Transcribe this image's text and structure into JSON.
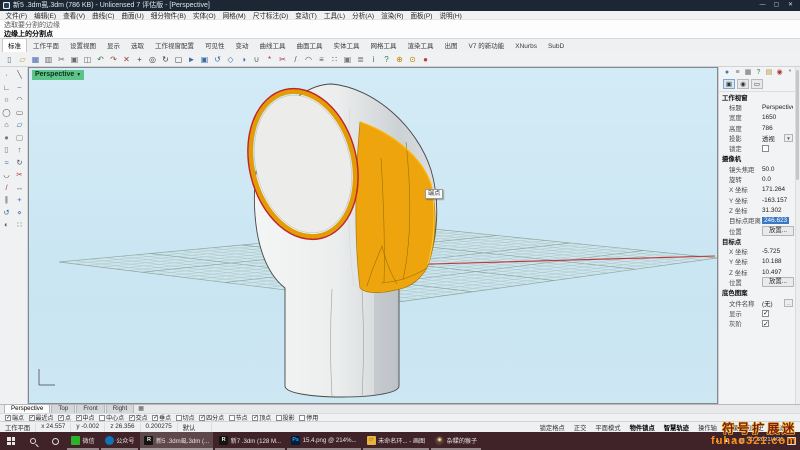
{
  "window": {
    "title": "新5 .3dm虱.3dm (786 KB) - Unlicensed 7 评估版 - [Perspective]",
    "minimize": "—",
    "maximize": "▢",
    "close": "✕"
  },
  "menu": {
    "items": [
      "文件(F)",
      "编辑(E)",
      "查看(V)",
      "曲线(C)",
      "曲面(U)",
      "细分物件(B)",
      "实体(O)",
      "网格(M)",
      "尺寸标注(D)",
      "变动(T)",
      "工具(L)",
      "分析(A)",
      "渲染(R)",
      "面板(P)",
      "说明(H)"
    ]
  },
  "command": {
    "history": "选取要分割的边缘",
    "prompt": "边缘上的分割点"
  },
  "ribbon_tabs": {
    "items": [
      {
        "label": "标准",
        "active": true
      },
      {
        "label": "工作平面"
      },
      {
        "label": "设置视图"
      },
      {
        "label": "显示"
      },
      {
        "label": "选取"
      },
      {
        "label": "工作视窗配置"
      },
      {
        "label": "可见性"
      },
      {
        "label": "变动"
      },
      {
        "label": "曲线工具"
      },
      {
        "label": "曲面工具"
      },
      {
        "label": "实体工具"
      },
      {
        "label": "网格工具"
      },
      {
        "label": "渲染工具"
      },
      {
        "label": "出图"
      },
      {
        "label": "V7 的新功能"
      },
      {
        "label": "XNurbs"
      },
      {
        "label": "SubD"
      }
    ]
  },
  "toolbar": {
    "icons": [
      {
        "n": "new-file-icon",
        "g": "▯",
        "css": "color:#56718a"
      },
      {
        "n": "open-file-icon",
        "g": "▱",
        "css": "color:#c9a24a"
      },
      {
        "n": "save-file-icon",
        "g": "▦",
        "css": "color:#4a6fae"
      },
      {
        "n": "print-icon",
        "g": "▥",
        "css": "color:#6a6a6a"
      },
      {
        "n": "cut-icon",
        "g": "✂",
        "css": "color:#6a6a6a"
      },
      {
        "n": "copy-icon",
        "g": "▣",
        "css": "color:#6a6a6a"
      },
      {
        "n": "paste-icon",
        "g": "◫",
        "css": "color:#6a6a6a"
      },
      {
        "n": "undo-icon",
        "g": "↶",
        "css": "color:#3b7c3b"
      },
      {
        "n": "redo-icon",
        "g": "↷",
        "css": "color:#8a4a3b"
      },
      {
        "n": "delete-icon",
        "g": "✕",
        "css": "color:#a33a3a"
      },
      {
        "n": "pan-icon",
        "g": "+",
        "css": "color:#444"
      },
      {
        "n": "zoom-icon",
        "g": "◎",
        "css": "color:#444"
      },
      {
        "n": "rotate-view-icon",
        "g": "↻",
        "css": "color:#444"
      },
      {
        "n": "zoom-extents-icon",
        "g": "▢",
        "css": "color:#444"
      },
      {
        "n": "move-icon",
        "g": "►",
        "css": "color:#3a6ea5"
      },
      {
        "n": "copy-object-icon",
        "g": "▣",
        "css": "color:#3a6ea5"
      },
      {
        "n": "rotate-icon",
        "g": "↺",
        "css": "color:#3a6ea5"
      },
      {
        "n": "scale-icon",
        "g": "◇",
        "css": "color:#3a6ea5"
      },
      {
        "n": "mirror-icon",
        "g": "◑",
        "css": "color:#3a6ea5"
      },
      {
        "n": "join-icon",
        "g": "∪",
        "css": "color:#555"
      },
      {
        "n": "explode-icon",
        "g": "*",
        "css": "color:#a33a3a"
      },
      {
        "n": "trim-icon",
        "g": "✂",
        "css": "color:#a33a3a"
      },
      {
        "n": "split-icon",
        "g": "/",
        "css": "color:#555"
      },
      {
        "n": "fillet-icon",
        "g": "◠",
        "css": "color:#555"
      },
      {
        "n": "offset-icon",
        "g": "≡",
        "css": "color:#555"
      },
      {
        "n": "array-icon",
        "g": "∷",
        "css": "color:#555"
      },
      {
        "n": "group-icon",
        "g": "▣",
        "css": "color:#777"
      },
      {
        "n": "layers-icon",
        "g": "≣",
        "css": "color:#777"
      },
      {
        "n": "properties-icon",
        "g": "i",
        "css": "color:#2a7a4a"
      },
      {
        "n": "help-icon",
        "g": "?",
        "css": "color:#2a7a4a"
      },
      {
        "n": "gumball-icon",
        "g": "⊕",
        "css": "color:#b58900"
      },
      {
        "n": "osnap-toggle-icon",
        "g": "⊙",
        "css": "color:#b58900"
      },
      {
        "n": "record-history-icon",
        "g": "●",
        "css": "color:#c03a3a"
      }
    ]
  },
  "left_toolbar": {
    "icons": [
      {
        "n": "point-tool-icon",
        "g": "·",
        "css": "color:#333"
      },
      {
        "n": "line-tool-icon",
        "g": "╲",
        "css": "color:#555"
      },
      {
        "n": "polyline-tool-icon",
        "g": "∟",
        "css": "color:#555"
      },
      {
        "n": "curve-tool-icon",
        "g": "~",
        "css": "color:#3a6ea5"
      },
      {
        "n": "circle-tool-icon",
        "g": "○",
        "css": "color:#555"
      },
      {
        "n": "arc-tool-icon",
        "g": "◠",
        "css": "color:#555"
      },
      {
        "n": "ellipse-tool-icon",
        "g": "◯",
        "css": "color:#555"
      },
      {
        "n": "rectangle-tool-icon",
        "g": "▭",
        "css": "color:#555"
      },
      {
        "n": "polygon-tool-icon",
        "g": "⌂",
        "css": "color:#555"
      },
      {
        "n": "surface-tool-icon",
        "g": "▱",
        "css": "color:#3a6ea5"
      },
      {
        "n": "sphere-tool-icon",
        "g": "●",
        "css": "color:#777"
      },
      {
        "n": "box-tool-icon",
        "g": "▢",
        "css": "color:#777"
      },
      {
        "n": "cylinder-tool-icon",
        "g": "▯",
        "css": "color:#777"
      },
      {
        "n": "extrude-tool-icon",
        "g": "↑",
        "css": "color:#555"
      },
      {
        "n": "loft-tool-icon",
        "g": "≈",
        "css": "color:#3a6ea5"
      },
      {
        "n": "revolve-tool-icon",
        "g": "↻",
        "css": "color:#555"
      },
      {
        "n": "fillet-curve-tool-icon",
        "g": "◡",
        "css": "color:#555"
      },
      {
        "n": "trim-tool-icon",
        "g": "✂",
        "css": "color:#a33a3a"
      },
      {
        "n": "split-tool-icon",
        "g": "/",
        "css": "color:#a33a3a"
      },
      {
        "n": "extend-tool-icon",
        "g": "↔",
        "css": "color:#555"
      },
      {
        "n": "offset-tool-icon",
        "g": "∥",
        "css": "color:#555"
      },
      {
        "n": "move-tool-icon",
        "g": "+",
        "css": "color:#3a6ea5"
      },
      {
        "n": "rotate-tool-icon",
        "g": "↺",
        "css": "color:#3a6ea5"
      },
      {
        "n": "scale-tool-icon",
        "g": "⋄",
        "css": "color:#3a6ea5"
      },
      {
        "n": "mirror-tool-icon",
        "g": "◐",
        "css": "color:#555"
      },
      {
        "n": "array-tool-icon",
        "g": "∷",
        "css": "color:#555"
      }
    ]
  },
  "viewport": {
    "label": "Perspective",
    "label_arrow": "▼",
    "snap_tooltip": "端点"
  },
  "panel": {
    "tab_icons": [
      {
        "n": "panel-tab-properties-icon",
        "g": "●",
        "css": "color:#2e7fc1"
      },
      {
        "n": "panel-tab-layers-icon",
        "g": "≡",
        "css": "color:#666"
      },
      {
        "n": "panel-tab-display-icon",
        "g": "▦",
        "css": "color:#666"
      },
      {
        "n": "panel-tab-help-icon",
        "g": "?",
        "css": "color:#2a8a4a"
      },
      {
        "n": "panel-tab-notes-icon",
        "g": "▤",
        "css": "color:#b08d2e"
      },
      {
        "n": "panel-tab-materials-icon",
        "g": "◉",
        "css": "color:#a43a3a"
      },
      {
        "n": "panel-tab-settings-icon",
        "g": "*",
        "css": "color:#666"
      }
    ],
    "view_icons": [
      {
        "n": "panel-viewport-props-icon",
        "g": "▣",
        "pressed": true
      },
      {
        "n": "panel-camera-icon",
        "g": "◉"
      },
      {
        "n": "panel-wallpaper-icon",
        "g": "▭"
      }
    ],
    "rows": [
      {
        "h": "工作视窗"
      },
      {
        "label": "标题",
        "value": "Perspective"
      },
      {
        "label": "宽度",
        "value": "1650"
      },
      {
        "label": "高度",
        "value": "786"
      },
      {
        "label": "投影",
        "value": "透视",
        "suffix": "▼"
      },
      {
        "label": "锁定",
        "is_check": true,
        "checked": false
      },
      {
        "h": "摄像机"
      },
      {
        "label": "镜头焦距",
        "value": "50.0"
      },
      {
        "label": "旋转",
        "value": "0.0"
      },
      {
        "label": "X 坐标",
        "value": "171.264"
      },
      {
        "label": "Y 坐标",
        "value": "-163.157"
      },
      {
        "label": "Z 坐标",
        "value": "31.302"
      },
      {
        "label": "目标点距离",
        "value": "246.623",
        "hl": true
      },
      {
        "label": "位置",
        "btn": "放置..."
      },
      {
        "h": "目标点"
      },
      {
        "label": "X 坐标",
        "value": "-5.725"
      },
      {
        "label": "Y 坐标",
        "value": "10.188"
      },
      {
        "label": "Z 坐标",
        "value": "10.497"
      },
      {
        "label": "位置",
        "btn": "放置..."
      },
      {
        "h": "底色图案"
      },
      {
        "label": "文件名称",
        "value": "(无)",
        "suffix": "…"
      },
      {
        "label": "显示",
        "is_check": true,
        "checked": true
      },
      {
        "label": "灰阶",
        "is_check": true,
        "checked": true
      }
    ]
  },
  "viewport_tabs": {
    "items": [
      {
        "label": "Perspective",
        "active": true
      },
      {
        "label": "Top"
      },
      {
        "label": "Front"
      },
      {
        "label": "Right"
      }
    ],
    "layout_icon": "▦"
  },
  "osnap": {
    "items": [
      {
        "label": "端点",
        "checked": true
      },
      {
        "label": "最近点",
        "checked": true
      },
      {
        "label": "点",
        "checked": true
      },
      {
        "label": "中点",
        "checked": true
      },
      {
        "label": "中心点",
        "checked": false
      },
      {
        "label": "交点",
        "checked": true
      },
      {
        "label": "垂点",
        "checked": true
      },
      {
        "label": "切点",
        "checked": false
      },
      {
        "label": "四分点",
        "checked": true
      },
      {
        "label": "节点",
        "checked": false
      },
      {
        "label": "顶点",
        "checked": true
      },
      {
        "label": "投影",
        "checked": false
      },
      {
        "label": "停用",
        "checked": false
      }
    ]
  },
  "statusbar": {
    "cells": [
      "工作平面",
      "x 24.557",
      "y -0.002",
      "z 26.356",
      "0.200275",
      "默认"
    ],
    "toggles": [
      {
        "label": "锁定格点"
      },
      {
        "label": "正交"
      },
      {
        "label": "平面模式"
      },
      {
        "label": "物件锁点",
        "active": true
      },
      {
        "label": "智慧轨迹",
        "active": true
      },
      {
        "label": "操作轴"
      },
      {
        "label": "记录建构历史"
      },
      {
        "label": "过滤器"
      }
    ]
  },
  "taskbar": {
    "apps": [
      {
        "n": "taskbar-wechat",
        "label": "微信",
        "glyph": "",
        "css": "background:#2bb32a"
      },
      {
        "n": "taskbar-official-account",
        "label": "公众号",
        "glyph": "",
        "css": "background:#1273b5;border-radius:50%"
      },
      {
        "n": "taskbar-rhino-file-5",
        "label": "新5 .3dm虱.3dm (...",
        "glyph": "R",
        "css": "background:#141414;color:#eee",
        "active": true
      },
      {
        "n": "taskbar-rhino-file-7",
        "label": "新7 .3dm (128 M...",
        "glyph": "R",
        "css": "background:#141414;color:#eee"
      },
      {
        "n": "taskbar-photoshop",
        "label": "15.4.png @ 214%...",
        "glyph": "Ps",
        "css": "background:#001e36;color:#2fa3f7"
      },
      {
        "n": "taskbar-paint",
        "label": "未命名环... - 画图",
        "glyph": "▱",
        "css": "background:#e8b33c;color:#7a4a12"
      },
      {
        "n": "taskbar-monkey-app",
        "label": "杂糅的猴子",
        "glyph": "◉",
        "css": "background:#5a3a28;border-radius:50%;color:#f3e0c8"
      }
    ],
    "tray": {
      "icons": [
        {
          "n": "tray-chevron-icon",
          "g": "∧"
        },
        {
          "n": "tray-security-icon",
          "g": "▲"
        },
        {
          "n": "tray-volume-icon",
          "g": "♪"
        },
        {
          "n": "tray-network-icon",
          "g": "▥"
        },
        {
          "n": "tray-ime-icon",
          "g": "中"
        }
      ],
      "date": "2021/4/26"
    }
  },
  "watermark": {
    "line1": "符号扩展迷",
    "line2": "fuhao321.com"
  },
  "colors": {
    "titlebar": "#1c2733",
    "taskbar": "#3f2328",
    "viewport_bg": "#cde8f4",
    "model_orange": "#eea50d",
    "rim_red": "#c32525",
    "selected_edge_yellow": "#ffb400",
    "axis_red": "#c23434",
    "axis_green": "#2f8f2f",
    "selection_blue": "#3a78c3",
    "viewport_label_green": "#5cc488"
  }
}
